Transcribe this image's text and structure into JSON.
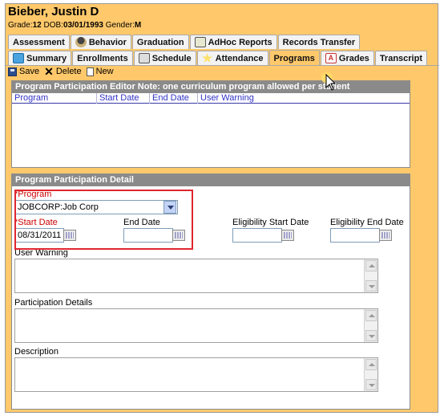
{
  "student": {
    "name": "Bieber, Justin D",
    "grade_label": "Grade:",
    "grade": "12",
    "dob_label": "DOB:",
    "dob": "03/01/1993",
    "gender_label": "Gender:",
    "gender": "M"
  },
  "tabs_row1": [
    {
      "label": "Assessment",
      "icon": "none"
    },
    {
      "label": "Behavior",
      "icon": "behavior-icon"
    },
    {
      "label": "Graduation",
      "icon": "none"
    },
    {
      "label": "AdHoc Reports",
      "icon": "adhoc-reports-icon"
    },
    {
      "label": "Records Transfer",
      "icon": "none"
    }
  ],
  "tabs_row2": [
    {
      "label": "Summary",
      "icon": "summary-icon"
    },
    {
      "label": "Enrollments",
      "icon": "none"
    },
    {
      "label": "Schedule",
      "icon": "schedule-icon"
    },
    {
      "label": "Attendance",
      "icon": "attendance-icon"
    },
    {
      "label": "Programs",
      "icon": "none",
      "active": true
    },
    {
      "label": "Grades",
      "icon": "grades-icon"
    },
    {
      "label": "Transcript",
      "icon": "none"
    }
  ],
  "toolbar": {
    "save_label": "Save",
    "delete_label": "Delete",
    "new_label": "New"
  },
  "editor_panel": {
    "title": "Program Participation Editor Note: one curriculum program allowed per student",
    "columns": [
      "Program",
      "Start Date",
      "End Date",
      "User Warning"
    ]
  },
  "detail_panel": {
    "title": "Program Participation Detail",
    "program_label": "*Program",
    "program_value": "JOBCORP:Job Corp",
    "start_date_label": "*Start Date",
    "start_date_value": "08/31/2011",
    "end_date_label": "End Date",
    "end_date_value": "",
    "elig_start_label": "Eligibility Start Date",
    "elig_start_value": "",
    "elig_end_label": "Eligibility End Date",
    "elig_end_value": "",
    "user_warning_label": "User Warning",
    "participation_details_label": "Participation Details",
    "description_label": "Description"
  },
  "colors": {
    "background": "#ffc96b",
    "panel_header": "#8a8a8a",
    "required_label": "#cc0000",
    "highlight": "#e0262e",
    "grid_header_text": "#3232c8"
  }
}
